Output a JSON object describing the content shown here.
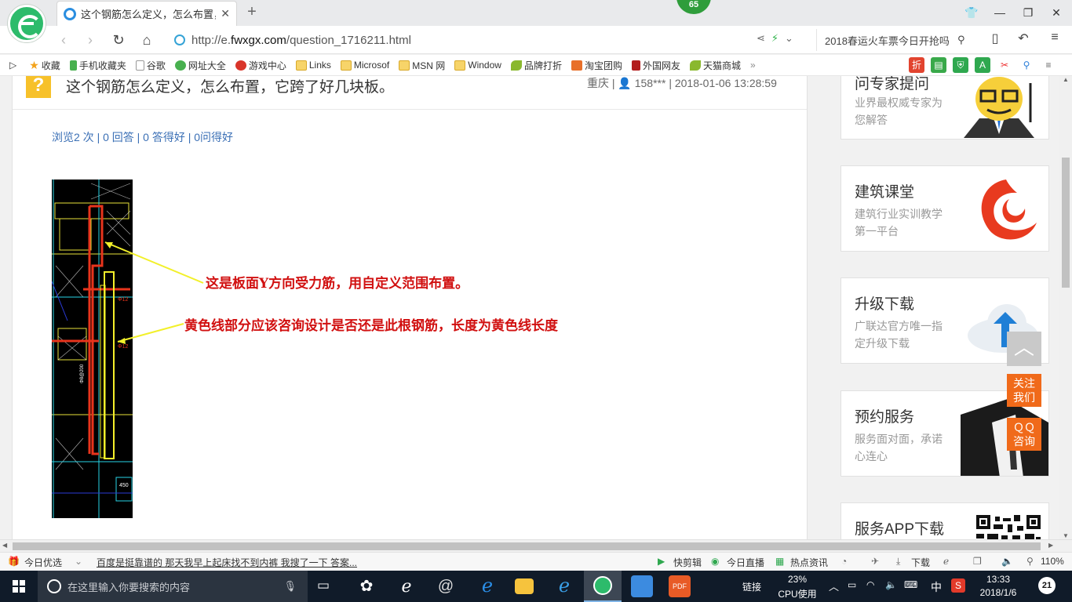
{
  "browser": {
    "tab_title": "这个钢筋怎么定义，怎么布置，它",
    "tab_close": "✕",
    "new_tab": "+",
    "badge": "65",
    "url_prefix": "http://e.",
    "url_domain": "fwxgx.com",
    "url_path": "/question_1716211.html",
    "search_text": "2018春运火车票今日开抢吗",
    "window_controls": [
      "minimize",
      "restore",
      "close"
    ]
  },
  "bookmarks": [
    {
      "label": "收藏",
      "icon": "star-icon"
    },
    {
      "label": "手机收藏夹",
      "icon": "phone-icon"
    },
    {
      "label": "谷歌",
      "icon": "page-icon"
    },
    {
      "label": "网址大全",
      "icon": "globe-icon"
    },
    {
      "label": "游戏中心",
      "icon": "game-icon"
    },
    {
      "label": "Links",
      "icon": "folder-icon"
    },
    {
      "label": "Microsof",
      "icon": "folder-icon"
    },
    {
      "label": "MSN 网",
      "icon": "folder-icon"
    },
    {
      "label": "Window",
      "icon": "folder-icon"
    },
    {
      "label": "品牌打折",
      "icon": "leaf-icon"
    },
    {
      "label": "淘宝团购",
      "icon": "taobao-icon"
    },
    {
      "label": "外国网友",
      "icon": "flag-icon"
    },
    {
      "label": "天猫商城",
      "icon": "leaf-icon"
    }
  ],
  "question": {
    "title": "这个钢筋怎么定义，怎么布置，它跨了好几块板。",
    "meta": "重庆 | 👤 158*** | 2018-01-06 13:28:59",
    "stats": "浏览2 次 | 0 回答 | 0 答得好 | 0问得好",
    "annotation_1": "这是板面Y方向受力筋，用自定义范围布置。",
    "annotation_2": "黄色线部分应该咨询设计是否还是此根钢筋，长度为黄色线长度"
  },
  "sidebar": [
    {
      "title": "问专家提问",
      "sub": "业界最权威专家为您解答"
    },
    {
      "title": "建筑课堂",
      "sub": "建筑行业实训教学第一平台"
    },
    {
      "title": "升级下载",
      "sub": "广联达官方唯一指定升级下载"
    },
    {
      "title": "预约服务",
      "sub": "服务面对面，承诺心连心"
    },
    {
      "title": "服务APP下载",
      "sub": ""
    }
  ],
  "float_buttons": {
    "follow": "关注我们",
    "qq": "ＱＱ咨询"
  },
  "statusbar": {
    "today": "今日优选",
    "news": "百度是挺靠谱的 那天我早上起床找不到内裤 我搜了一下 答案...",
    "clip": "快剪辑",
    "live": "今日直播",
    "hot": "热点资讯",
    "download": "下载",
    "zoom": "110%"
  },
  "taskbar": {
    "search_placeholder": "在这里输入你要搜索的内容",
    "link": "链接",
    "cpu_pct": "23%",
    "cpu_label": "CPU使用",
    "ime": "中",
    "time": "13:33",
    "date": "2018/1/6",
    "notif_count": "21"
  },
  "colors": {
    "accent_green": "#2dbb6b",
    "link_blue": "#3a6fb5",
    "annotation_red": "#d11010",
    "float_orange": "#f06a1a"
  }
}
